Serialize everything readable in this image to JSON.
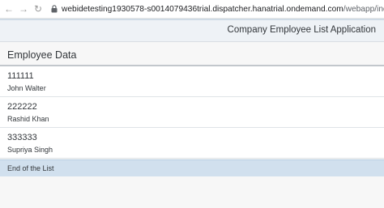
{
  "browser": {
    "url_host": "webidetesting1930578-s0014079436trial.dispatcher.hanatrial.ondemand.com",
    "url_path": "/webapp/index.html?hc_or"
  },
  "app": {
    "title": "Company Employee List Application"
  },
  "list": {
    "header": "Employee Data",
    "items": [
      {
        "id": "111111",
        "name": "John Walter"
      },
      {
        "id": "222222",
        "name": "Rashid Khan"
      },
      {
        "id": "333333",
        "name": "Supriya Singh"
      }
    ],
    "end_text": "End of the List"
  }
}
